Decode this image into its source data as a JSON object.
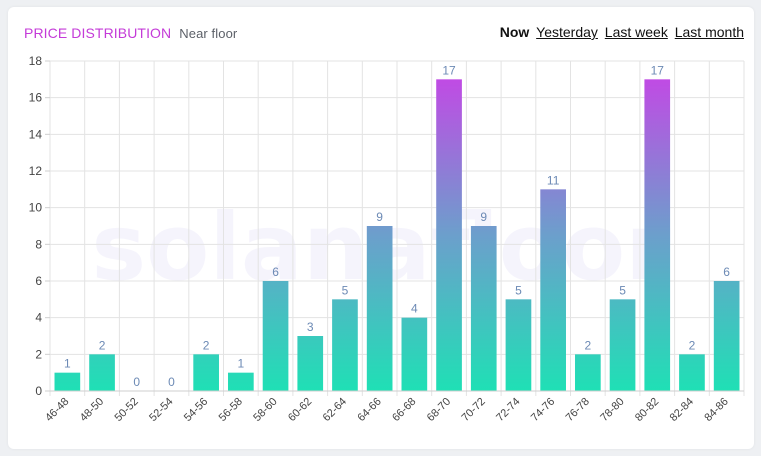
{
  "header": {
    "title": "PRICE DISTRIBUTION",
    "subtitle": "Near floor",
    "periods": [
      "Now",
      "Yesterday",
      "Last week",
      "Last month"
    ],
    "active_period": "Now"
  },
  "watermark": "solanafloor",
  "colors": {
    "title": "#c43bd8",
    "bar_low": "#1fe0b5",
    "bar_mid": "#6c9fcc",
    "bar_high": "#c04be4",
    "value_label": "#6c8ab5",
    "axis_text": "#444444",
    "grid": "#e3e3e3"
  },
  "chart_data": {
    "type": "bar",
    "categories": [
      "46-48",
      "48-50",
      "50-52",
      "52-54",
      "54-56",
      "56-58",
      "58-60",
      "60-62",
      "62-64",
      "64-66",
      "66-68",
      "68-70",
      "70-72",
      "72-74",
      "74-76",
      "76-78",
      "78-80",
      "80-82",
      "82-84",
      "84-86"
    ],
    "values": [
      1,
      2,
      0,
      0,
      2,
      1,
      6,
      3,
      5,
      9,
      4,
      17,
      9,
      5,
      11,
      2,
      5,
      17,
      2,
      6
    ],
    "ylim": [
      0,
      18
    ],
    "yticks": [
      0,
      2,
      4,
      6,
      8,
      10,
      12,
      14,
      16,
      18
    ],
    "grid": true,
    "data_labels": true,
    "legend": false
  }
}
